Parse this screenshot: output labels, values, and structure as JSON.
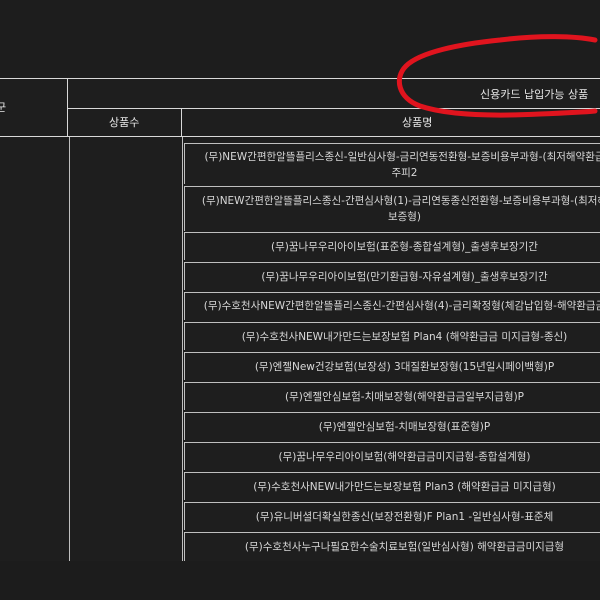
{
  "table": {
    "left_header_fragment": "군",
    "title": "신용카드 납입가능 상품",
    "col_count": "상품수",
    "col_name": "상품명",
    "rows": [
      {
        "line1": "(무)NEW간편한알뜰플리스종신-일반심사형-금리연동전환형-보증비용부과형-(최저해약환급",
        "line2": "주피2"
      },
      {
        "line1": "(무)NEW간편한알뜰플리스종신-간편심사형(1)-금리연동종신전환형-보증비용부과형-(최저해",
        "line2": "보증형)"
      },
      {
        "line1": "(무)꿈나무우리아이보험(표준형-종합설계형)_출생후보장기간",
        "line2": ""
      },
      {
        "line1": "(무)꿈나무우리아이보험(만기환급형-자유설계형)_출생후보장기간",
        "line2": ""
      },
      {
        "line1": "(무)수호천사NEW간편한알뜰플리스종신-간편심사형(4)-금리확정형(체감납입형-해약환급금",
        "line2": ""
      },
      {
        "line1": "(무)수호천사NEW내가만드는보장보험 Plan4 (해약환급금 미지급형-종신)",
        "line2": ""
      },
      {
        "line1": "(무)엔젤New건강보험(보장성) 3대질환보장형(15년일시페이백형)P",
        "line2": ""
      },
      {
        "line1": "(무)엔젤안심보험-치매보장형(해약환급금일부지급형)P",
        "line2": ""
      },
      {
        "line1": "(무)엔젤안심보험-치매보장형(표준형)P",
        "line2": ""
      },
      {
        "line1": "(무)꿈나무우리아이보험(해약환급금미지급형-종합설계형)",
        "line2": ""
      },
      {
        "line1": "(무)수호천사NEW내가만드는보장보험 Plan3 (해약환급금 미지급형)",
        "line2": ""
      },
      {
        "line1": "(무)유니버셜더확실한종신(보장전환형)F Plan1 -일반심사형-표준체",
        "line2": ""
      },
      {
        "line1": "(무)수호천사누구나필요한수술치료보험(일반심사형) 해약환급금미지급형",
        "line2": ""
      }
    ]
  },
  "annotation": {
    "color": "#e0141e"
  }
}
